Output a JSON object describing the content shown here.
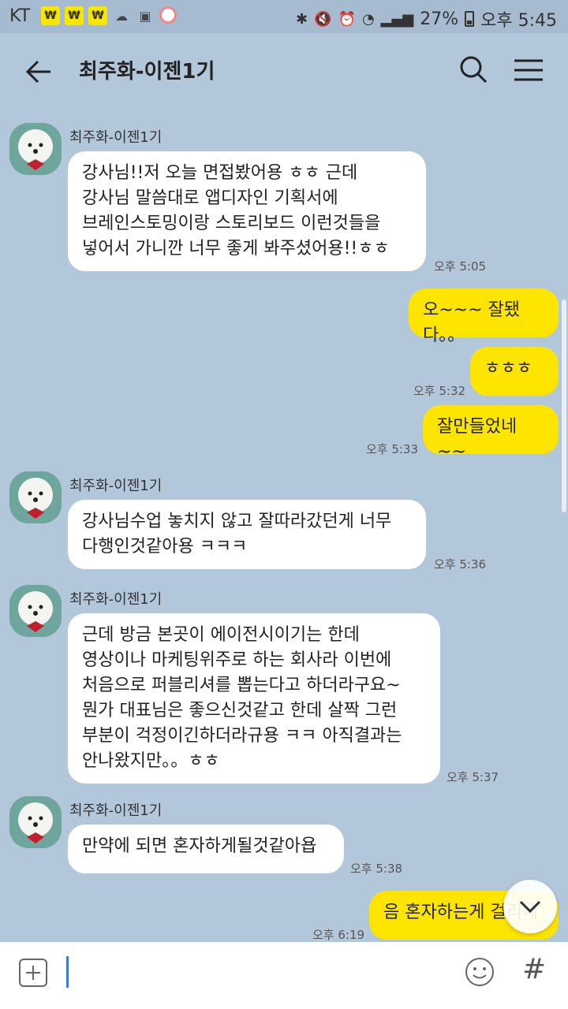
{
  "statusbar": {
    "carrier": "KT",
    "won_badges": [
      "₩",
      "₩",
      "₩"
    ],
    "battery": "27%",
    "time": "오후 5:45"
  },
  "header": {
    "title": "최주화-이젠1기"
  },
  "messages": [
    {
      "sender": "최주화-이젠1기",
      "text": "강사님!!저 오늘 면접봤어용 ㅎㅎ 근데\n강사님 말씀대로 앱디자인 기획서에\n브레인스토밍이랑 스토리보드 이런것들을\n넣어서 가니깐 너무 좋게 봐주셨어용!!ㅎㅎ",
      "time": "오후 5:05"
    },
    {
      "text": "오~~~ 잘됐다。。",
      "time": ""
    },
    {
      "text": "ㅎㅎㅎ",
      "time": "오후 5:32"
    },
    {
      "text": "잘만들었네~~",
      "time": "오후 5:33"
    },
    {
      "sender": "최주화-이젠1기",
      "text": "강사님수업 놓치지 않고 잘따라갔던게 너무\n다행인것같아용 ㅋㅋㅋ",
      "time": "오후 5:36"
    },
    {
      "sender": "최주화-이젠1기",
      "text": "근데 방금 본곳이 에이전시이기는 한데\n영상이나 마케팅위주로 하는 회사라 이번에\n처음으로 퍼블리셔를 뽑는다고 하더라구요~\n뭔가 대표님은 좋으신것같고 한데 살짝 그런\n부분이 걱정이긴하더라규용 ㅋㅋ 아직결과는\n안나왔지만。。ㅎㅎ",
      "time": "오후 5:37"
    },
    {
      "sender": "최주화-이젠1기",
      "text": "만약에 되면 혼자하게될것같아욥",
      "time": "오후 5:38"
    },
    {
      "text": "음 혼자하는게 걸리네",
      "time": "오후 6:19"
    }
  ],
  "icons": {
    "back": "arrow-left",
    "search": "magnifier",
    "menu": "hamburger",
    "scroll_down": "chevron-down",
    "attach": "plus-square",
    "emoji": "smiley",
    "hash": "#"
  },
  "colors": {
    "chat_background": "#b2c7da",
    "my_bubble": "#fee500",
    "other_bubble": "#ffffff"
  }
}
